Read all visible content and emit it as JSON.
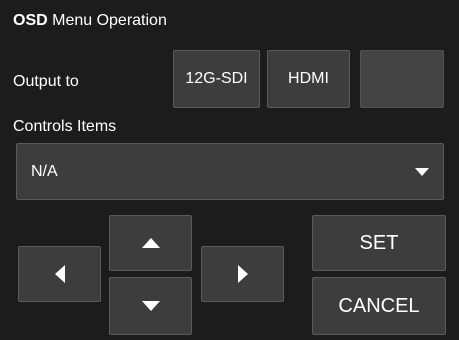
{
  "header": {
    "title_bold": "OSD",
    "title_rest": " Menu Operation"
  },
  "output": {
    "label": "Output to",
    "buttons": [
      "12G-SDI",
      "HDMI",
      ""
    ]
  },
  "controls": {
    "label": "Controls Items",
    "selected": "N/A"
  },
  "actions": {
    "set": "SET",
    "cancel": "CANCEL"
  },
  "icons": {
    "dropdown": "chevron-down-icon",
    "up": "arrow-up-icon",
    "down": "arrow-down-icon",
    "left": "arrow-left-icon",
    "right": "arrow-right-icon"
  },
  "colors": {
    "background": "#1c1c1c",
    "button": "#3d3d3d",
    "border": "#5a5a5a",
    "text": "#ffffff"
  }
}
